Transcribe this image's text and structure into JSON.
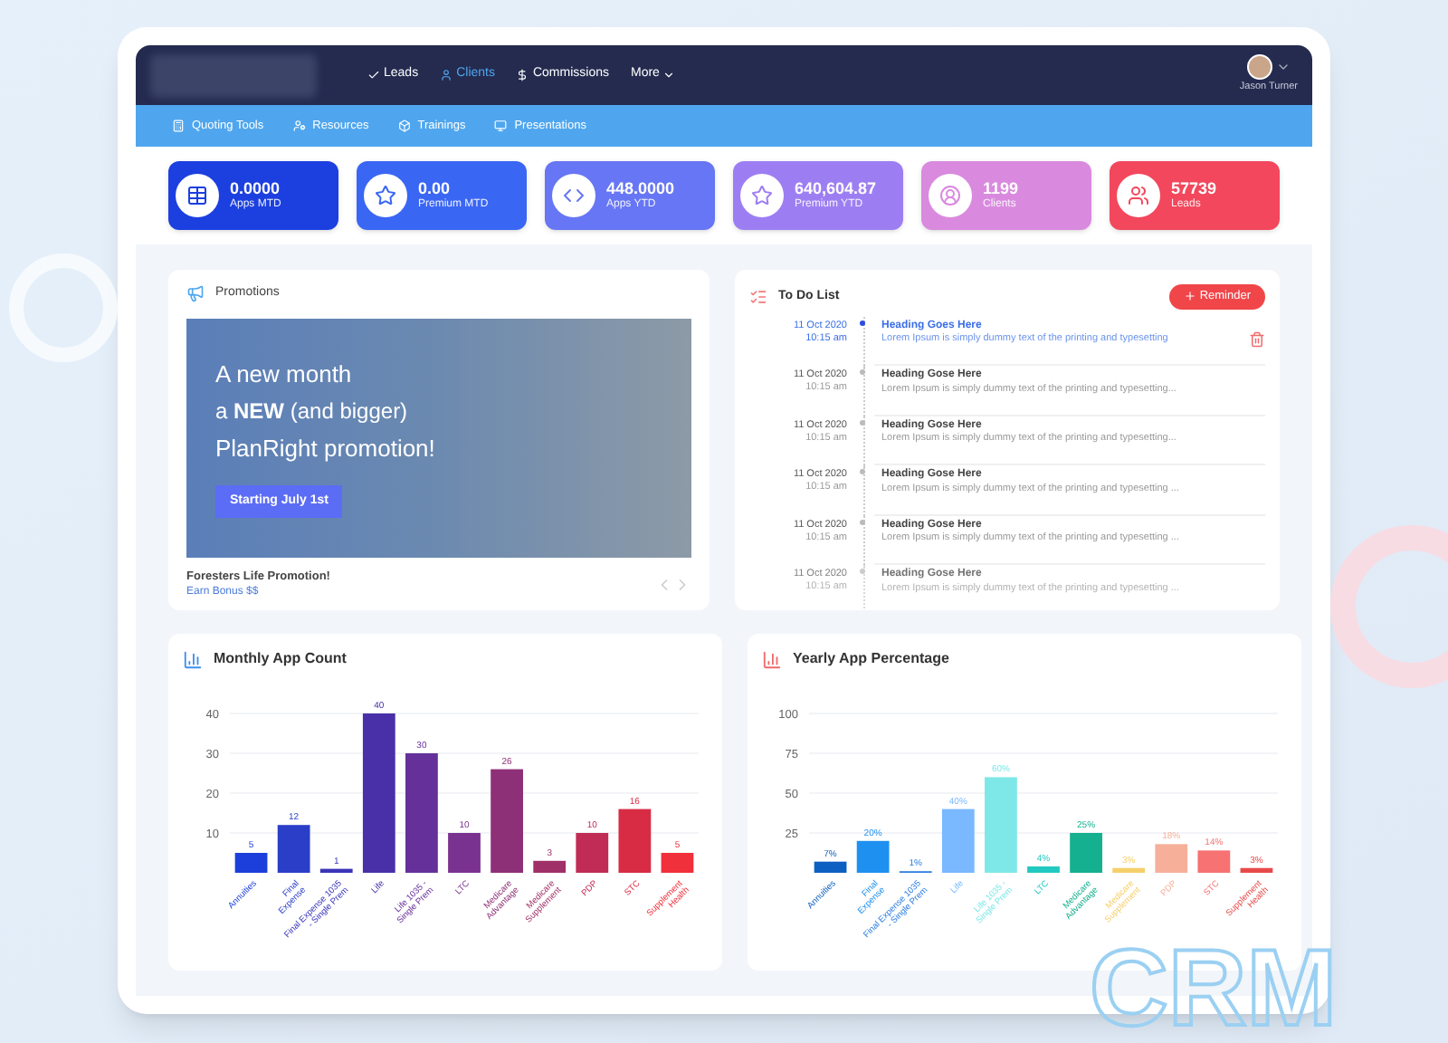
{
  "nav": {
    "items": [
      {
        "label": "Leads",
        "selected": false
      },
      {
        "label": "Clients",
        "selected": true
      },
      {
        "label": "Commissions",
        "selected": false
      },
      {
        "label": "More",
        "selected": false
      }
    ],
    "user": "Jason Turner"
  },
  "subnav": [
    "Quoting Tools",
    "Resources",
    "Trainings",
    "Presentations"
  ],
  "stats": [
    {
      "value": "0.0000",
      "label": "Apps MTD",
      "color": "#1c3fe0"
    },
    {
      "value": "0.00",
      "label": "Premium MTD",
      "color": "#3a66f4"
    },
    {
      "value": "448.0000",
      "label": "Apps YTD",
      "color": "#6676f4"
    },
    {
      "value": "640,604.87",
      "label": "Premium YTD",
      "color": "#9d7ef2"
    },
    {
      "value": "1199",
      "label": "Clients",
      "color": "#d98ade"
    },
    {
      "value": "57739",
      "label": "Leads",
      "color": "#f2475c"
    }
  ],
  "promotions": {
    "title": "Promotions",
    "banner": {
      "line1": "A new  month",
      "line2": "a **NEW** (and bigger)",
      "line3": "PlanRight promotion!",
      "button": "Starting July 1st"
    },
    "caption": "Foresters Life Promotion!",
    "subcaption": "Earn Bonus $$"
  },
  "todo": {
    "title": "To Do List",
    "button": "Reminder",
    "items": [
      {
        "date": "11 Oct 2020",
        "time": "10:15 am",
        "heading": "Heading Goes Here",
        "text": "Lorem Ipsum is simply dummy text of the printing and typesetting",
        "selected": true
      },
      {
        "date": "11 Oct 2020",
        "time": "10:15 am",
        "heading": "Heading Gose Here",
        "text": "Lorem Ipsum is simply dummy text of the printing and typesetting...",
        "selected": false
      },
      {
        "date": "11 Oct 2020",
        "time": "10:15 am",
        "heading": "Heading Gose Here",
        "text": "Lorem Ipsum is simply dummy text of the printing and typesetting...",
        "selected": false
      },
      {
        "date": "11 Oct 2020",
        "time": "10:15 am",
        "heading": "Heading Gose Here",
        "text": "Lorem Ipsum is simply dummy text of the printing and typesetting ...",
        "selected": false
      },
      {
        "date": "11 Oct 2020",
        "time": "10:15 am",
        "heading": "Heading Gose Here",
        "text": "Lorem Ipsum is simply dummy text of the printing and typesetting ...",
        "selected": false
      },
      {
        "date": "11 Oct 2020",
        "time": "10:15 am",
        "heading": "Heading Gose Here",
        "text": "Lorem Ipsum is simply dummy text of the printing and typesetting ...",
        "selected": false
      }
    ]
  },
  "monthly": {
    "title": "Monthly App Count",
    "chart_data": {
      "type": "bar",
      "categories": [
        "Annuities",
        "Final Expense",
        "Final Expense 1035 - Single Prem",
        "Life",
        "Life 1035 - Single Prem",
        "LTC",
        "Medicare Advantage",
        "Medicare Supplement",
        "PDP",
        "STC",
        "Supplement Health"
      ],
      "series": [
        {
          "color": "#1c3fdc",
          "values": [
            5,
            null,
            null,
            null,
            null,
            null,
            null,
            null,
            null,
            null,
            null
          ]
        },
        {
          "color": "#2a3ec8",
          "values": [
            null,
            12,
            null,
            null,
            null,
            null,
            null,
            null,
            null,
            null,
            null
          ]
        },
        {
          "color": "#3a35b8",
          "values": [
            null,
            null,
            1,
            null,
            null,
            null,
            null,
            null,
            null,
            null,
            null
          ]
        },
        {
          "color": "#4a30a8",
          "values": [
            null,
            null,
            null,
            40,
            null,
            null,
            null,
            null,
            null,
            null,
            null
          ]
        },
        {
          "color": "#66309a",
          "values": [
            null,
            null,
            null,
            null,
            30,
            null,
            null,
            null,
            null,
            null,
            null
          ]
        },
        {
          "color": "#7a3290",
          "values": [
            null,
            null,
            null,
            null,
            null,
            10,
            null,
            null,
            null,
            null,
            null
          ]
        },
        {
          "color": "#8e3078",
          "values": [
            null,
            null,
            null,
            null,
            null,
            null,
            26,
            null,
            null,
            null,
            null
          ]
        },
        {
          "color": "#a03068",
          "values": [
            null,
            null,
            null,
            null,
            null,
            null,
            null,
            3,
            null,
            null,
            null
          ]
        },
        {
          "color": "#c02c55",
          "values": [
            null,
            null,
            null,
            null,
            null,
            null,
            null,
            null,
            10,
            null,
            null
          ]
        },
        {
          "color": "#d82c45",
          "values": [
            null,
            null,
            null,
            null,
            null,
            null,
            null,
            null,
            null,
            16,
            null
          ]
        },
        {
          "color": "#f0303a",
          "values": [
            null,
            null,
            null,
            null,
            null,
            null,
            null,
            null,
            null,
            null,
            5
          ]
        }
      ],
      "ylim": [
        0,
        40
      ],
      "yticks": [
        10,
        20,
        30,
        40
      ],
      "grid": true,
      "data_labels": true
    }
  },
  "yearly": {
    "title": "Yearly App Percentage",
    "chart_data": {
      "type": "bar",
      "categories": [
        "Annuities",
        "Final Expense",
        "Final Expense 1035 - Single Prem",
        "Life",
        "Life 1035 - Single Prem",
        "LTC",
        "Medicare Advantage",
        "Medicare Supplement",
        "PDP",
        "STC",
        "Supplement Health"
      ],
      "series": [
        {
          "color": "#0d5fc2",
          "values": [
            7,
            null,
            null,
            null,
            null,
            null,
            null,
            null,
            null,
            null,
            null
          ]
        },
        {
          "color": "#1e90f0",
          "values": [
            null,
            20,
            null,
            null,
            null,
            null,
            null,
            null,
            null,
            null,
            null
          ]
        },
        {
          "color": "#2a7de0",
          "values": [
            null,
            null,
            1,
            null,
            null,
            null,
            null,
            null,
            null,
            null,
            null
          ]
        },
        {
          "color": "#7ab8ff",
          "values": [
            null,
            null,
            null,
            40,
            null,
            null,
            null,
            null,
            null,
            null,
            null
          ]
        },
        {
          "color": "#7ee8e8",
          "values": [
            null,
            null,
            null,
            null,
            60,
            null,
            null,
            null,
            null,
            null,
            null
          ]
        },
        {
          "color": "#22c9c0",
          "values": [
            null,
            null,
            null,
            null,
            null,
            4,
            null,
            null,
            null,
            null,
            null
          ]
        },
        {
          "color": "#14b08f",
          "values": [
            null,
            null,
            null,
            null,
            null,
            null,
            25,
            null,
            null,
            null,
            null
          ]
        },
        {
          "color": "#f5cf6a",
          "values": [
            null,
            null,
            null,
            null,
            null,
            null,
            null,
            3,
            null,
            null,
            null
          ]
        },
        {
          "color": "#f6b09a",
          "values": [
            null,
            null,
            null,
            null,
            null,
            null,
            null,
            null,
            18,
            null,
            null
          ]
        },
        {
          "color": "#f77272",
          "values": [
            null,
            null,
            null,
            null,
            null,
            null,
            null,
            null,
            null,
            14,
            null
          ]
        },
        {
          "color": "#e84a4a",
          "values": [
            null,
            null,
            null,
            null,
            null,
            null,
            null,
            null,
            null,
            null,
            3
          ]
        }
      ],
      "ylim": [
        0,
        100
      ],
      "yticks": [
        25,
        50,
        75,
        100
      ],
      "grid": true,
      "value_labels": [
        "7%",
        "20%",
        "1%",
        "40%",
        "60%",
        "4%",
        "25%",
        "3%",
        "18%",
        "14%",
        "3%"
      ]
    }
  },
  "overlay": "CRM"
}
